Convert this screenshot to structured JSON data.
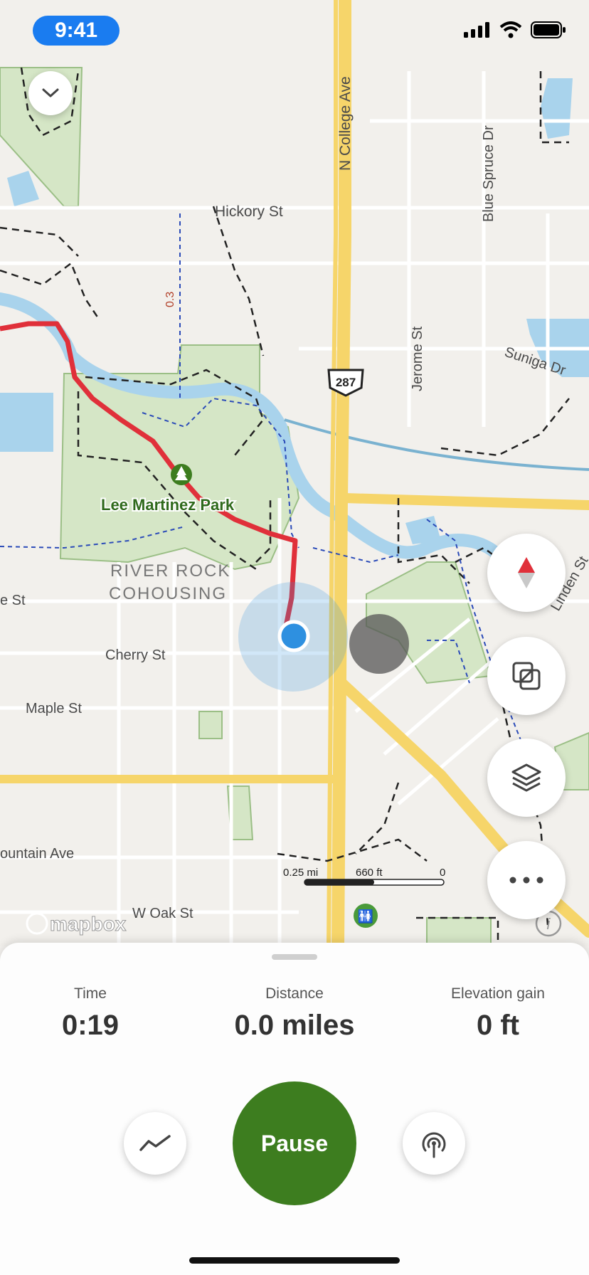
{
  "status": {
    "time": "9:41"
  },
  "map": {
    "streets": {
      "hickory": "Hickory St",
      "college": "N College Ave",
      "blue_spruce": "Blue Spruce Dr",
      "jerome": "Jerome St",
      "suniga": "Suniga Dr",
      "cherry": "Cherry St",
      "maple": "Maple St",
      "mountain": "ountain Ave",
      "oak": "W Oak St",
      "linden": "Linden St",
      "left_st": "e St"
    },
    "highway_shield": "287",
    "park_name": "Lee Martinez Park",
    "area_label_1": "RIVER ROCK",
    "area_label_2": "COHOUSING",
    "trail_distance": "0.3",
    "scale": {
      "a": "0.25 mi",
      "b": "660 ft",
      "c": "0"
    },
    "attribution": "mapbox",
    "colors": {
      "route": "#e0303a",
      "park": "#cfe3bf",
      "water": "#a9d3ec",
      "highway": "#f6d56a",
      "location": "#2e90e0"
    }
  },
  "controls": {
    "collapse_icon": "chevron-down-icon",
    "compass_icon": "compass-icon",
    "overlay_icon": "overlay-icon",
    "layers_icon": "layers-icon",
    "more_icon": "ellipsis-icon",
    "info_icon": "info-icon"
  },
  "stats": {
    "time_label": "Time",
    "time_value": "0:19",
    "distance_label": "Distance",
    "distance_value": "0.0 miles",
    "elevation_label": "Elevation gain",
    "elevation_value": "0 ft"
  },
  "actions": {
    "pause_label": "Pause",
    "stats_icon": "chart-line-icon",
    "beacon_icon": "broadcast-icon"
  }
}
